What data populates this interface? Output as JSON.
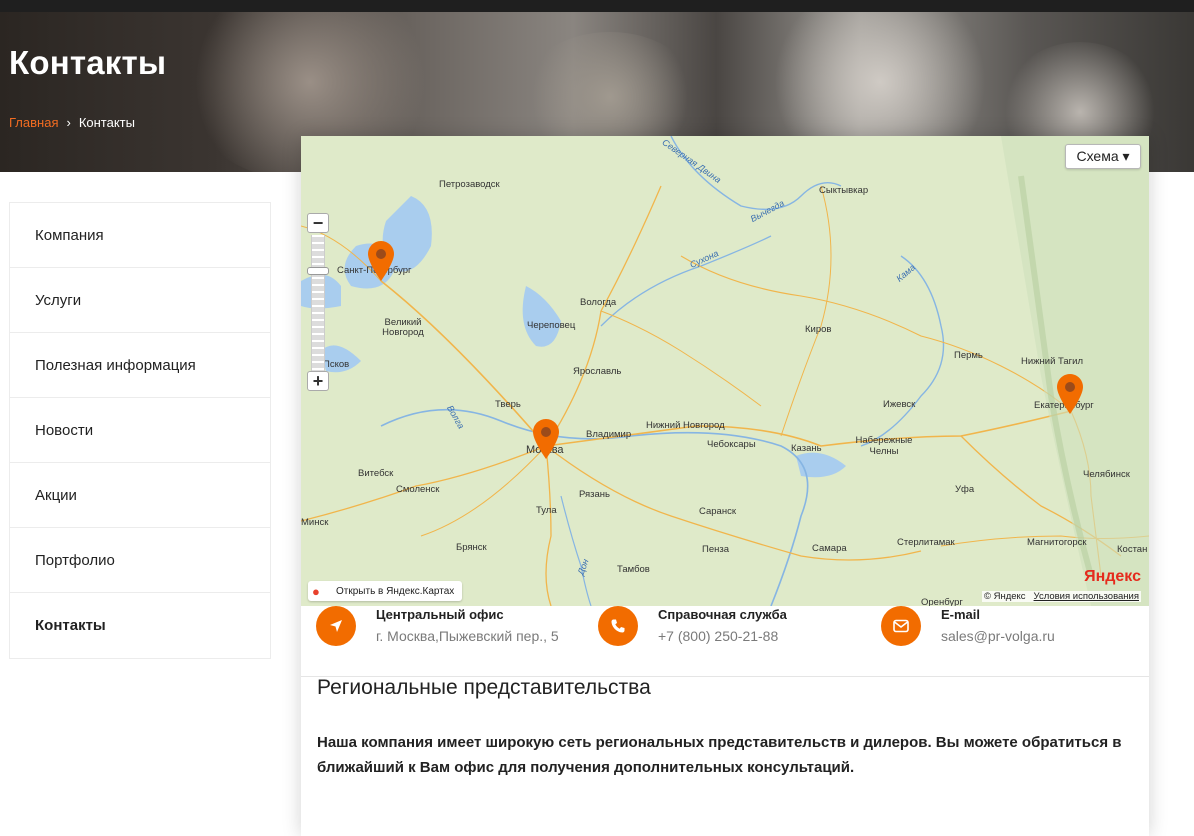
{
  "page": {
    "title": "Контакты",
    "breadcrumb": {
      "home": "Главная",
      "current": "Контакты"
    }
  },
  "sidebar": {
    "items": [
      {
        "label": "Компания"
      },
      {
        "label": "Услуги"
      },
      {
        "label": "Полезная информация"
      },
      {
        "label": "Новости"
      },
      {
        "label": "Акции"
      },
      {
        "label": "Портфолио"
      },
      {
        "label": "Контакты",
        "active": true
      }
    ]
  },
  "map": {
    "scheme_button": "Схема ▾",
    "open_in_yandex": "Открыть в Яндекс.Картах",
    "logo": "Яндекс",
    "copyright": "© Яндекс",
    "terms": "Условия использования",
    "zoom_in": "+",
    "zoom_out": "−",
    "cities": [
      "Петрозаводск",
      "Сыктывкар",
      "Санкт-Петербург",
      "Вологда",
      "Великий Новгород",
      "Череповец",
      "Киров",
      "Пермь",
      "Нижний Тагил",
      "Ярославль",
      "Псков",
      "Тверь",
      "Ижевск",
      "Екатеринбург",
      "Нижний Новгород",
      "Москва",
      "Владимир",
      "Чебоксары",
      "Набережные Челны",
      "Казань",
      "Витебск",
      "Смоленск",
      "Рязань",
      "Уфа",
      "Челябинск",
      "Минск",
      "Тула",
      "Саранск",
      "Брянск",
      "Пенза",
      "Самара",
      "Стерлитамак",
      "Магнитогорск",
      "Тамбов",
      "Костан",
      "Оренбург"
    ],
    "rivers": [
      "Северная Двина",
      "Вычегда",
      "Сухона",
      "Кама",
      "Волга",
      "Дон"
    ],
    "marker_color": "#f26c00"
  },
  "contacts": [
    {
      "title": "Центральный офис",
      "value": "г. Москва,Пыжевский пер., 5",
      "icon": "navigation-arrow-icon"
    },
    {
      "title": "Справочная служба",
      "value": "+7 (800) 250-21-88",
      "icon": "phone-icon"
    },
    {
      "title": "E-mail",
      "value": "sales@pr-volga.ru",
      "icon": "mail-icon"
    }
  ],
  "regional": {
    "title": "Региональные представительства",
    "text": "Наша компания имеет широкую сеть региональных представительств и дилеров. Вы можете обратиться в ближайший к Вам офис для получения дополнительных консультаций."
  },
  "colors": {
    "accent": "#f26c00",
    "breadcrumb_home": "#f26c21"
  }
}
